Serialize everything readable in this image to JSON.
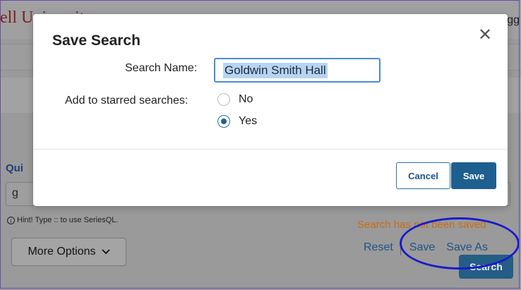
{
  "background": {
    "logo_text": "ell University",
    "nav_right_text": "gg",
    "quick_label": "Qui",
    "search_value": "g",
    "hint_icon": "info-icon",
    "hint_text": "Hint! Type :: to use SeriesQL.",
    "more_options_label": "More Options",
    "status_text": "Search has not been saved",
    "reset_label": "Reset",
    "save_label": "Save",
    "save_as_label": "Save As",
    "search_button_label": "Search"
  },
  "modal": {
    "title": "Save Search",
    "close_icon": "close-icon",
    "search_name_label": "Search Name:",
    "search_name_value": "Goldwin Smith Hall",
    "starred_label": "Add to starred searches:",
    "options": [
      {
        "label": "No",
        "checked": false
      },
      {
        "label": "Yes",
        "checked": true
      }
    ],
    "cancel_label": "Cancel",
    "save_label": "Save"
  },
  "colors": {
    "accent": "#1f5f8f",
    "status_warning": "#c96a15",
    "annotation": "#1a1acc"
  }
}
